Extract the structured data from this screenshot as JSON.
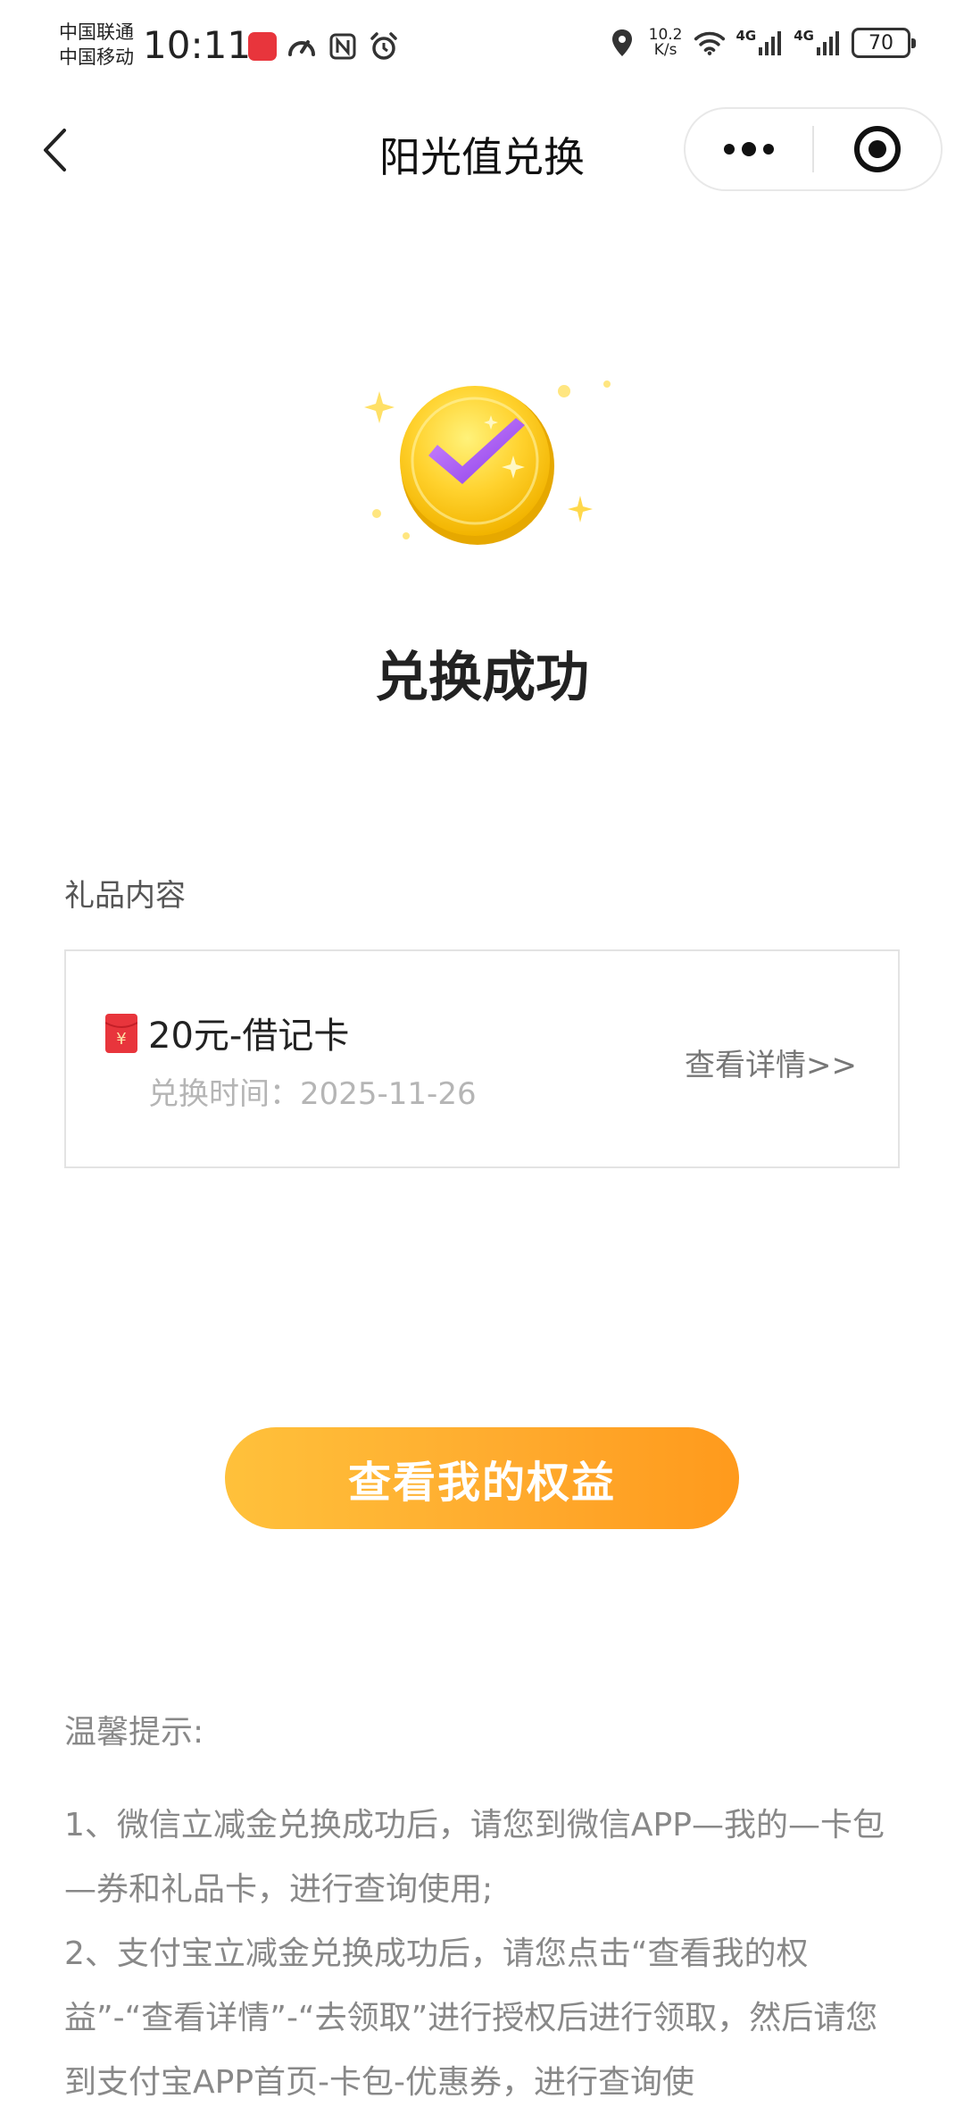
{
  "status_bar": {
    "carrier_1": "中国联通",
    "carrier_2": "中国移动",
    "time": "10:11",
    "net_speed_value": "10.2",
    "net_speed_unit": "K/s",
    "signal_1": "4G",
    "signal_2": "4G",
    "battery": "70",
    "icons": [
      "app-badge-icon",
      "speedometer-icon",
      "nfc-icon",
      "alarm-icon",
      "location-icon",
      "wifi-icon",
      "signal-icon",
      "battery-icon"
    ]
  },
  "nav": {
    "title": "阳光值兑换",
    "icons": [
      "back-arrow-icon",
      "more-dots-icon",
      "close-target-icon"
    ]
  },
  "result": {
    "title": "兑换成功",
    "icon": "success-check-coin-icon"
  },
  "gift": {
    "section_label": "礼品内容",
    "name": "20元-借记卡",
    "time_label": "兑换时间：",
    "time_value": "2025-11-26",
    "detail_link": "查看详情>>",
    "icon": "red-envelope-icon"
  },
  "cta": {
    "label": "查看我的权益"
  },
  "tips": {
    "title": "温馨提示:",
    "lines": [
      "1、微信立减金兑换成功后，请您到微信APP—我的—卡包—券和礼品卡，进行查询使用;",
      "2、支付宝立减金兑换成功后，请您点击“查看我的权益”-“查看详情”-“去领取”进行授权后进行领取，然后请您到支付宝APP首页-卡包-优惠券，进行查询使"
    ]
  },
  "colors": {
    "cta_start": "#ffc13b",
    "cta_end": "#ff9a1c",
    "envelope": "#e8353c",
    "coin": "#ffd43a",
    "check": "#a855f7"
  }
}
